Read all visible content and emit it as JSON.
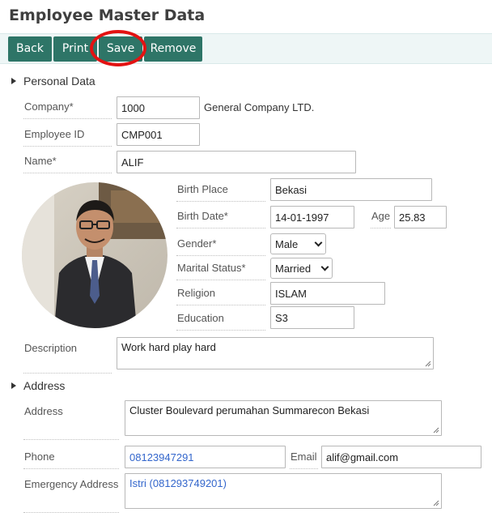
{
  "page": {
    "title": "Employee Master Data"
  },
  "toolbar": {
    "back": "Back",
    "print": "Print",
    "save": "Save",
    "remove": "Remove"
  },
  "personal": {
    "section_title": "Personal Data",
    "company": {
      "label": "Company*",
      "value": "1000",
      "name": "General Company LTD."
    },
    "employee_id": {
      "label": "Employee ID",
      "value": "CMP001"
    },
    "name": {
      "label": "Name*",
      "value": "ALIF"
    },
    "birth_place": {
      "label": "Birth Place",
      "value": "Bekasi"
    },
    "birth_date": {
      "label": "Birth Date*",
      "value": "14-01-1997"
    },
    "age": {
      "label": "Age",
      "value": "25.83"
    },
    "gender": {
      "label": "Gender*",
      "value": "Male"
    },
    "marital_status": {
      "label": "Marital Status*",
      "value": "Married"
    },
    "religion": {
      "label": "Religion",
      "value": "ISLAM"
    },
    "education": {
      "label": "Education",
      "value": "S3"
    },
    "description": {
      "label": "Description",
      "value": "Work hard play hard"
    }
  },
  "address": {
    "section_title": "Address",
    "address": {
      "label": "Address",
      "value": "Cluster Boulevard perumahan Summarecon Bekasi"
    },
    "phone": {
      "label": "Phone",
      "value": "08123947291"
    },
    "email": {
      "label": "Email",
      "value": "alif@gmail.com"
    },
    "emergency": {
      "label": "Emergency Address",
      "value": "Istri (081293749201)"
    }
  },
  "colors": {
    "button": "#2e7567",
    "highlight": "#e31212",
    "link_text": "#3366cc"
  }
}
